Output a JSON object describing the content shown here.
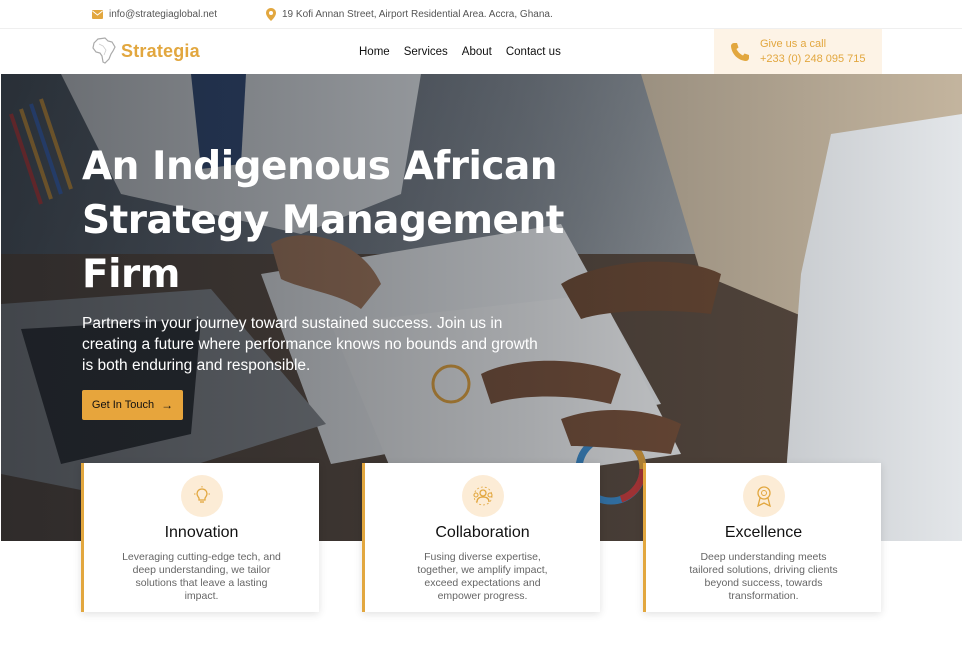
{
  "topbar": {
    "email": "info@strategiaglobal.net",
    "address": "19 Kofi Annan Street, Airport Residential Area. Accra, Ghana."
  },
  "navbar": {
    "logo_text": "Strategia",
    "links": [
      "Home",
      "Services",
      "About",
      "Contact us"
    ],
    "call_label": "Give us a call",
    "call_number": "+233 (0) 248 095 715"
  },
  "hero": {
    "title_lines": [
      "An Indigenous African",
      "Strategy Management",
      "Firm"
    ],
    "subtitle": "Partners in your journey toward sustained success. Join us in creating a future where performance knows no bounds and growth is both enduring and responsible.",
    "button_label": "Get In Touch"
  },
  "features": [
    {
      "title": "Innovation",
      "description": "Leveraging cutting-edge tech, and deep understanding, we tailor solutions that leave a lasting impact.",
      "icon": "lightbulb-icon"
    },
    {
      "title": "Collaboration",
      "description": "Fusing diverse expertise, together, we amplify impact, exceed expectations and empower progress.",
      "icon": "team-icon"
    },
    {
      "title": "Excellence",
      "description": "Deep understanding meets tailored solutions, driving clients beyond success, towards transformation.",
      "icon": "award-icon"
    }
  ],
  "colors": {
    "accent": "#e2a73f",
    "callbox_bg": "#fdf3e6",
    "icon_circle_bg": "#fcecd6"
  }
}
